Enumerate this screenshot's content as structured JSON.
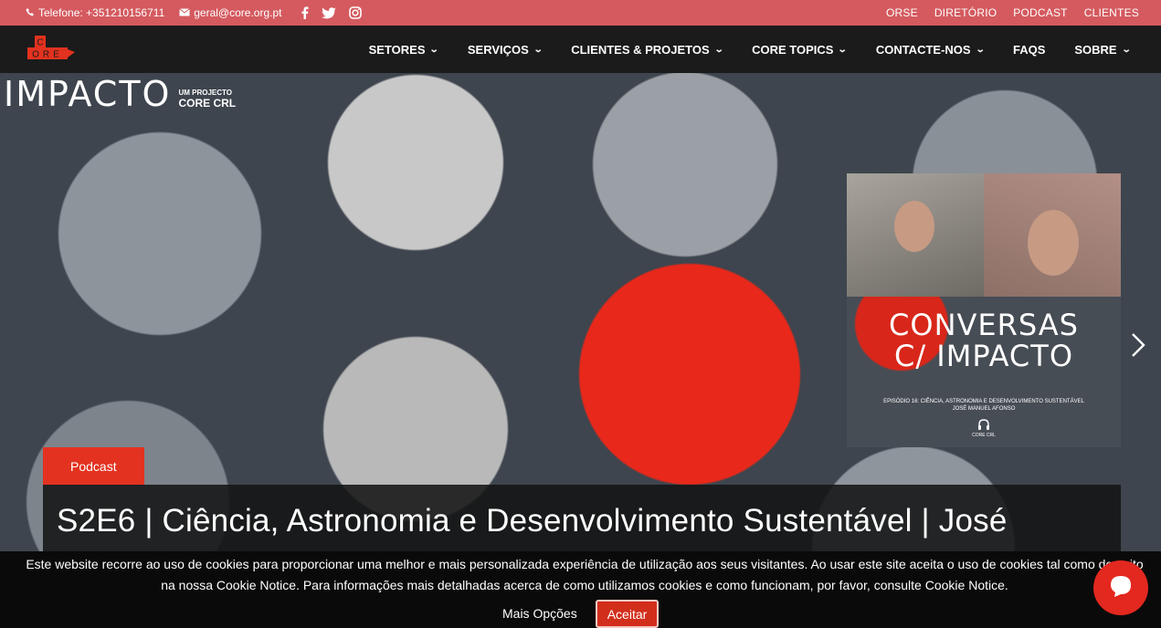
{
  "topbar": {
    "phone": "Telefone: +351210156711",
    "email": "geral@core.org.pt",
    "social": [
      "facebook-icon",
      "twitter-icon",
      "instagram-icon"
    ],
    "links": [
      "ORSE",
      "DIRETÓRIO",
      "PODCAST",
      "CLIENTES"
    ]
  },
  "nav": {
    "logo_top": "C",
    "logo_bottom": "ORE",
    "items": [
      "SETORES",
      "SERVIÇOS",
      "CLIENTES & PROJETOS",
      "CORE TOPICS",
      "CONTACTE-NOS",
      "FAQS",
      "SOBRE"
    ],
    "dropdown_items": [
      true,
      true,
      true,
      true,
      true,
      false,
      true
    ]
  },
  "hero": {
    "brand_big": "IMPACTO",
    "brand_small_1": "UM PROJECTO",
    "brand_small_2": "CORE CRL",
    "thumb_title_1": "CONVERSAS",
    "thumb_title_2": "C/ IMPACTO",
    "thumb_sub_1": "EPISÓDIO 16: CIÊNCIA, ASTRONOMIA E DESENVOLVIMENTO SUSTENTÁVEL",
    "thumb_sub_2": "JOSÉ MANUEL AFONSO",
    "thumb_sub_3": "CORE CRL",
    "badge": "Podcast",
    "title": "S2E6 | Ciência, Astronomia e Desenvolvimento Sustentável | José"
  },
  "cookie": {
    "text": "Este website recorre ao uso de cookies para proporcionar uma melhor e mais personalizada experiência de utilização aos seus visitantes. Ao usar este site aceita o uso de cookies tal como descrito na nossa Cookie Notice. Para informações mais detalhadas acerca de como utilizamos cookies e como funcionam, por favor, consulte Cookie Notice.",
    "more_label": "Mais Opções",
    "accept_label": "Aceitar"
  },
  "colors": {
    "topbar": "#d45a5f",
    "accent": "#e3321f",
    "nav": "#1b1b1b"
  }
}
